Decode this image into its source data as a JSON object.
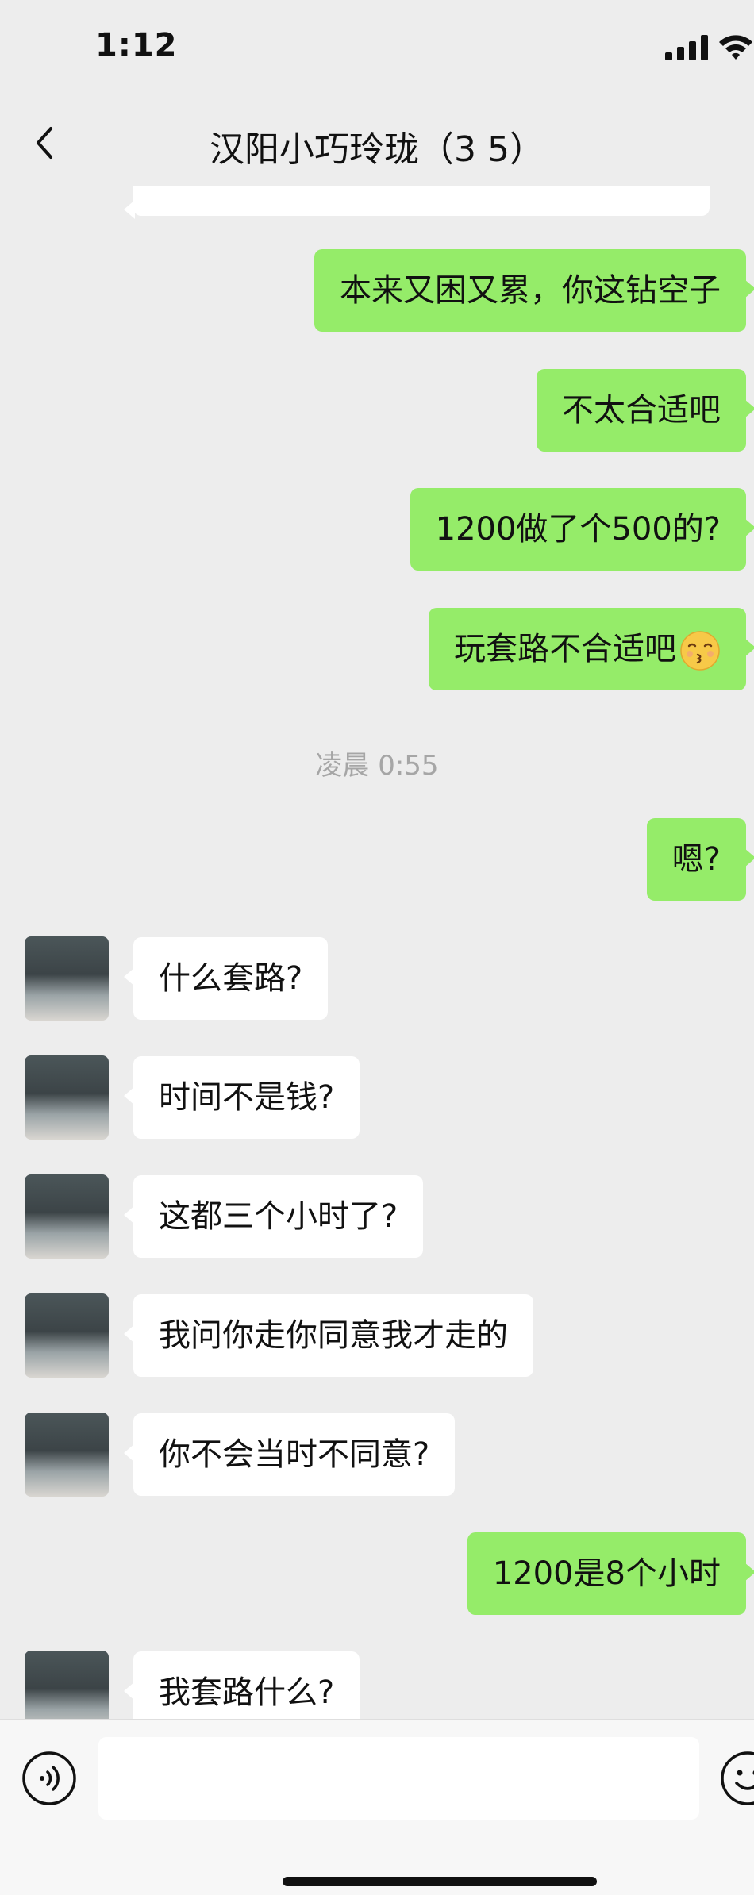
{
  "status": {
    "time": "1:12"
  },
  "nav": {
    "title": "汉阳小巧玲珑（3   5）"
  },
  "messages": [
    {
      "side": "out",
      "text": "本来又困又累，你这钻空子"
    },
    {
      "side": "out",
      "text": "不太合适吧"
    },
    {
      "side": "out",
      "text": "1200做了个500的?"
    },
    {
      "side": "out",
      "text": "玩套路不合适吧"
    },
    {
      "side": "time",
      "text": "凌晨 0:55"
    },
    {
      "side": "out",
      "text": "嗯?"
    },
    {
      "side": "in",
      "text": "什么套路?"
    },
    {
      "side": "in",
      "text": "时间不是钱?"
    },
    {
      "side": "in",
      "text": "这都三个小时了?"
    },
    {
      "side": "in",
      "text": "我问你走你同意我才走的"
    },
    {
      "side": "in",
      "text": "你不会当时不同意?"
    },
    {
      "side": "out",
      "text": "1200是8个小时"
    },
    {
      "side": "in",
      "text": "我套路什么?"
    }
  ],
  "input": {
    "placeholder": ""
  },
  "colors": {
    "outgoing_bubble": "#95ec69",
    "incoming_bubble": "#ffffff",
    "background": "#ededed"
  }
}
